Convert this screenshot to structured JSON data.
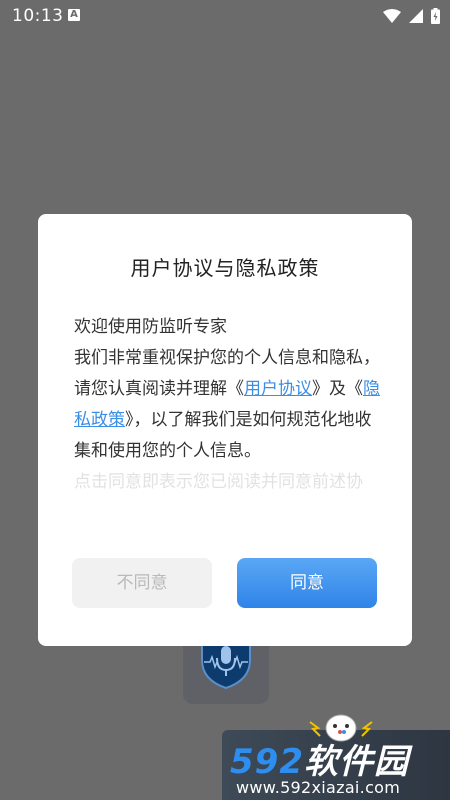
{
  "status_bar": {
    "time": "10:13",
    "notification_letter": "A"
  },
  "dialog": {
    "title": "用户协议与隐私政策",
    "welcome": "欢迎使用防监听专家",
    "p2_a": "我们非常重视保护您的个人信息和隐私，请您认真阅读并理解《",
    "user_agreement_link": "用户协议",
    "p2_b": "》及《",
    "privacy_policy_link": "隐私政策",
    "p2_c": "》，以了解我们是如何规范化地收集和使用您的个人信息。",
    "p3_faded": "点击同意即表示您已阅读并同意前述协",
    "disagree_label": "不同意",
    "agree_label": "同意"
  },
  "watermark": {
    "brand_num": "592",
    "brand_text": "软件园",
    "url": "www.592xiazai.com"
  },
  "colors": {
    "accent": "#2f84e8",
    "link": "#3a8ee6",
    "overlay": "#6b6b6b"
  }
}
